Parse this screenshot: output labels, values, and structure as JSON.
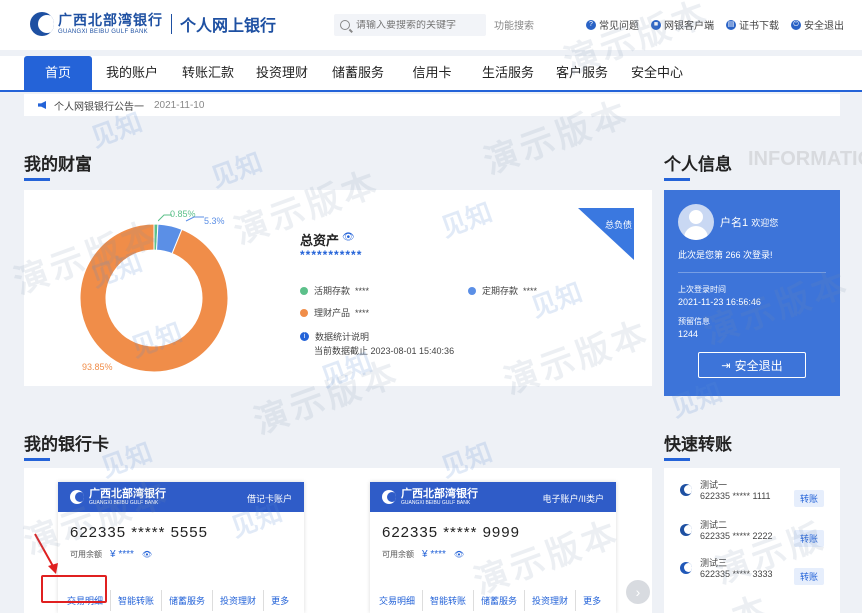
{
  "header": {
    "bank_name_cn": "广西北部湾银行",
    "bank_name_en": "GUANGXI BEIBU GULF BANK",
    "portal_title": "个人网上银行",
    "search_placeholder": "请输入要搜索的关键字",
    "search_button": "功能搜索",
    "links": [
      {
        "label": "常见问题",
        "icon": "question-icon"
      },
      {
        "label": "网银客户端",
        "icon": "client-icon"
      },
      {
        "label": "证书下载",
        "icon": "certificate-icon"
      },
      {
        "label": "安全退出",
        "icon": "logout-icon"
      }
    ]
  },
  "nav": {
    "items": [
      "首页",
      "我的账户",
      "转账汇款",
      "投资理财",
      "储蓄服务",
      "信用卡",
      "生活服务",
      "客户服务",
      "安全中心"
    ],
    "active_index": 0
  },
  "notice": {
    "text": "个人网银银行公告一",
    "date": "2021-11-10"
  },
  "wealth": {
    "title": "我的财富",
    "asset_title": "总资产",
    "asset_value": "***********",
    "debt_label": "总负债",
    "legend": [
      {
        "label": "活期存款",
        "value": "****",
        "color": "#5cc08a"
      },
      {
        "label": "定期存款",
        "value": "****",
        "color": "#5b8fe6"
      },
      {
        "label": "理财产品",
        "value": "****",
        "color": "#f08d49"
      }
    ],
    "stats_title": "数据统计说明",
    "stats_time": "当前数据截止 2023-08-01 15:40:36"
  },
  "chart_data": {
    "type": "pie",
    "categories": [
      "活期存款",
      "定期存款",
      "理财产品"
    ],
    "values": [
      0.85,
      5.3,
      93.85
    ],
    "labels": [
      "0.85%",
      "5.3%",
      "93.85%"
    ],
    "colors": [
      "#5cc08a",
      "#5b8fe6",
      "#f08d49"
    ]
  },
  "personal": {
    "title": "个人信息",
    "watermark": "INFORMATIO",
    "username": "户名1",
    "welcome": "欢迎您",
    "login_count_text": "此次是您第 266 次登录!",
    "last_login_label": "上次登录时间",
    "last_login_value": "2021-11-23 16:56:46",
    "reserved_label": "预留信息",
    "reserved_value": "1244",
    "logout_label": "安全退出"
  },
  "cards": {
    "title": "我的银行卡",
    "items": [
      {
        "bank": "广西北部湾银行",
        "bank_en": "GUANGXI BEIBU GULF BANK",
        "type": "借记卡账户",
        "number": "622335 ***** 5555",
        "balance_label": "可用余额",
        "balance_value": "¥ ****",
        "actions": [
          "交易明细",
          "智能转账",
          "储蓄服务",
          "投资理财",
          "更多"
        ]
      },
      {
        "bank": "广西北部湾银行",
        "bank_en": "GUANGXI BEIBU GULF BANK",
        "type": "电子账户/II类户",
        "number": "622335 ***** 9999",
        "balance_label": "可用余额",
        "balance_value": "¥ ****",
        "actions": [
          "交易明细",
          "智能转账",
          "储蓄服务",
          "投资理财",
          "更多"
        ]
      }
    ],
    "next": "›"
  },
  "quick_transfer": {
    "title": "快速转账",
    "items": [
      {
        "name": "测试一",
        "account": "622335 ***** 1111",
        "button": "转账"
      },
      {
        "name": "测试二",
        "account": "622335 ***** 2222",
        "button": "转账"
      },
      {
        "name": "测试三",
        "account": "622335 ***** 3333",
        "button": "转账"
      }
    ]
  },
  "watermarks": {
    "text": "演示版本",
    "brand": "见知",
    "brand_en": "XENCIO.COM"
  }
}
